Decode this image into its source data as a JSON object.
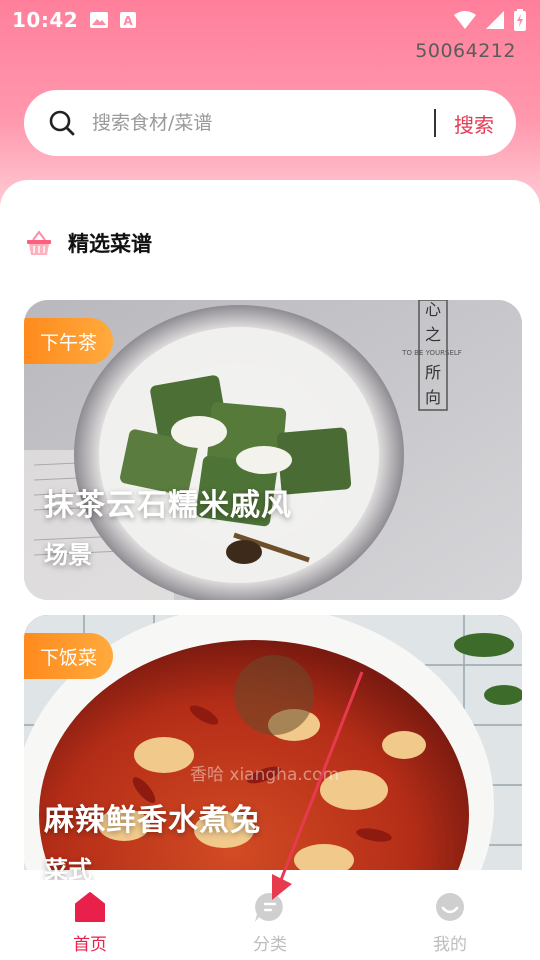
{
  "status_bar": {
    "time": "10:42",
    "icons": [
      "image-icon",
      "a-notification-icon",
      "wifi-icon",
      "signal-icon",
      "battery-icon"
    ]
  },
  "user": {
    "id": "50064212"
  },
  "search": {
    "placeholder": "搜索食材/菜谱",
    "button_label": "搜索"
  },
  "section": {
    "title": "精选菜谱",
    "icon": "basket-icon"
  },
  "recipes": [
    {
      "tag": "下午茶",
      "title": "抹茶云石糯米戚风",
      "subtitle": "场景",
      "image_texts": [
        "心",
        "之",
        "所",
        "向",
        "TO BE YOURSELF"
      ]
    },
    {
      "tag": "下饭菜",
      "title": "麻辣鲜香水煮兔",
      "subtitle": "菜式"
    }
  ],
  "watermark": "香哈 xiangha.com",
  "tabs": [
    {
      "label": "首页",
      "icon": "home-icon",
      "active": true
    },
    {
      "label": "分类",
      "icon": "category-chat-icon",
      "active": false
    },
    {
      "label": "我的",
      "icon": "profile-smile-icon",
      "active": false
    }
  ],
  "colors": {
    "accent": "#e8204a",
    "tag_gradient_start": "#ff8a1d",
    "tag_gradient_end": "#ffaa3d",
    "header_pink": "#ff7f9b",
    "annotation_arrow": "#e83a4f"
  }
}
